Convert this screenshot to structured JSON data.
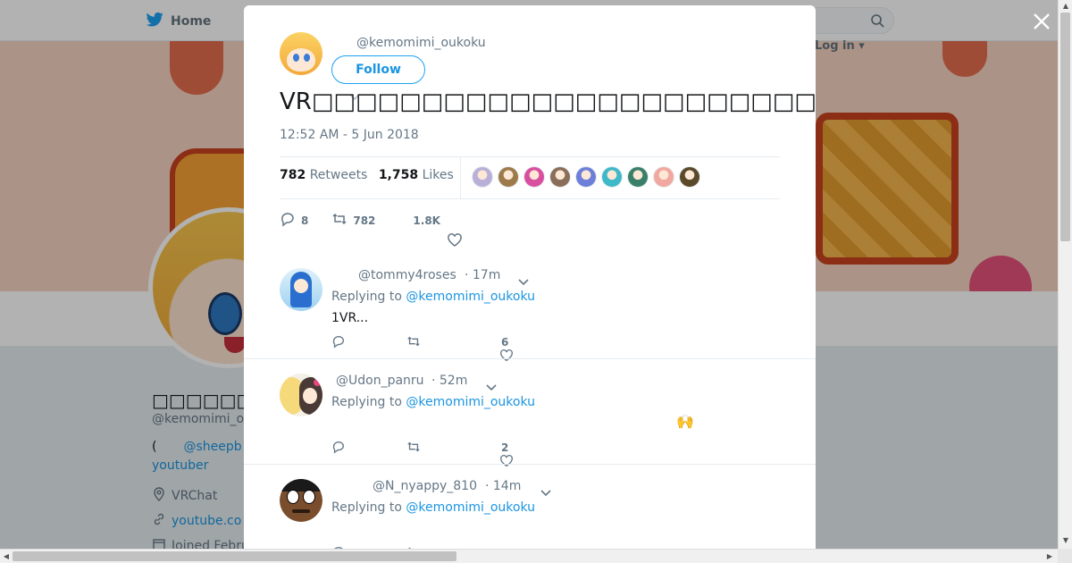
{
  "nav": {
    "home_label": "Home",
    "login_label": "Log in"
  },
  "background_profile": {
    "name": "□□□□□□□□□□□",
    "handle": "@kemomimi_o",
    "bio_prefix": "(",
    "bio_link": "@sheepb",
    "bio_line2": "youtuber",
    "location": "VRChat",
    "website": "youtube.co",
    "joined": "Joined Febru"
  },
  "tweet": {
    "handle": "@kemomimi_oukoku",
    "follow_label": "Follow",
    "text": "VR□□□□□□□□□□□□□□□□□□□□□□□□□□□□□□□□□□□□□□□□□□□□□□□□□□□□□□□□□□□□□□□□□",
    "timestamp": "12:52 AM - 5 Jun 2018",
    "retweets_count": "782",
    "retweets_label": "Retweets",
    "likes_count": "1,758",
    "likes_label": "Likes",
    "reply_count": "8",
    "retweet_action_count": "782",
    "like_action_count": "1.8K",
    "liker_colors": [
      "#b9b0d8",
      "#9c7a4a",
      "#d94fa0",
      "#8b6e5a",
      "#6d7fd8",
      "#3fb8c8",
      "#3a7f6a",
      "#f0a8a0",
      "#5a4a2a"
    ]
  },
  "replies": [
    {
      "handle": "@tommy4roses",
      "time": "· 17m",
      "replying_to_prefix": "Replying to",
      "replying_to": "@kemomimi_oukoku",
      "text": "1VR...",
      "emoji": "",
      "like_count": "6"
    },
    {
      "handle": "@Udon_panru",
      "time": "· 52m",
      "replying_to_prefix": "Replying to",
      "replying_to": "@kemomimi_oukoku",
      "text": "",
      "emoji": "🙌",
      "like_count": "2"
    },
    {
      "handle": "@N_nyappy_810",
      "time": "· 14m",
      "replying_to_prefix": "Replying to",
      "replying_to": "@kemomimi_oukoku",
      "text": "",
      "emoji": "",
      "like_count": ""
    }
  ],
  "colors": {
    "accent": "#1da1f2",
    "link": "#1b95e0",
    "text_secondary": "#657786",
    "divider": "#e6ecf0"
  }
}
